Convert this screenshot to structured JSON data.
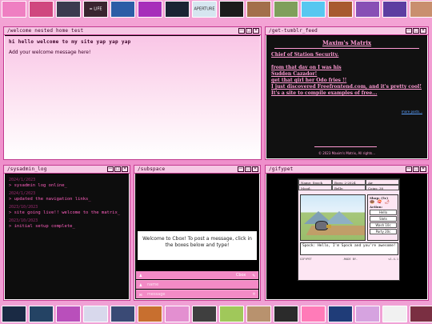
{
  "top_strip": [
    {
      "color": "#ef7fc2"
    },
    {
      "color": "#d0477f"
    },
    {
      "color": "#3b3b4f"
    },
    {
      "color": "#3a2430"
    },
    {
      "color": "#2c5da6"
    },
    {
      "color": "#a72fba"
    },
    {
      "color": "#1a2433"
    },
    {
      "color": "#d6e6f0"
    },
    {
      "color": "#1b1b1b"
    },
    {
      "color": "#a36f4a"
    },
    {
      "color": "#7f9f5b"
    },
    {
      "color": "#57c7f0"
    },
    {
      "color": "#a85a2f"
    },
    {
      "color": "#884fb5"
    },
    {
      "color": "#5d3da1"
    },
    {
      "color": "#c98f6e"
    },
    {
      "color": "#332233"
    }
  ],
  "top_strip_text": {
    "life": "= LIFE",
    "aperture": "APERTURE"
  },
  "bottom_strip": [
    {
      "color": "#1a2a44"
    },
    {
      "color": "#244364"
    },
    {
      "color": "#b94fbb"
    },
    {
      "color": "#d8d8ec"
    },
    {
      "color": "#3a4a75"
    },
    {
      "color": "#c86f2f"
    },
    {
      "color": "#e38fd0"
    },
    {
      "color": "#3f3f3f"
    },
    {
      "color": "#a0c85a"
    },
    {
      "color": "#b8926e"
    },
    {
      "color": "#2b2b2b"
    },
    {
      "color": "#ff7bb8"
    },
    {
      "color": "#1f3c78"
    },
    {
      "color": "#d6a3e0"
    },
    {
      "color": "#f1f1f1"
    },
    {
      "color": "#7a2f42"
    },
    {
      "color": "#d49b61"
    }
  ],
  "windows": {
    "w1": {
      "title": "/welcome nested home test",
      "heading": "hi hello welcome to my site yap yap yap",
      "text": "Add your welcome message here!"
    },
    "w2": {
      "title": "/get-tumblr_feed",
      "blog_title": "Maxim's Matrix",
      "entries": [
        "Chief of Station Security.",
        "from that day on I was his",
        "Sudden Cazador!",
        "get that girl her Odo fries !!",
        "I just discovered Freefrontend.com, and it's pretty cool! It's a site to compile examples of free..."
      ],
      "more": "more posts...",
      "copy": "© 2023 Maxim's Matrix, All rights..."
    },
    "w3": {
      "title": "/sysadmin_log",
      "logs": [
        {
          "date": "2024/1/2023",
          "msg": "> sysadmin log online_"
        },
        {
          "date": "2024/1/2023",
          "msg": "> updated the navigation links_"
        },
        {
          "date": "2023/10/2023",
          "msg": "> site going live!! welcome to the matrix_"
        },
        {
          "date": "2023/10/2023",
          "msg": "> initial setup complete_"
        }
      ]
    },
    "w4": {
      "title": "/subspace",
      "notice": "Welcome to Cbox! To post a message, click in the boxes below and type!",
      "cbox_label": "Cbox",
      "name_placeholder": "name",
      "message_placeholder": "message"
    },
    "w5": {
      "title": "/gifypet",
      "name": "Name: Spock",
      "born": "Born: 2-2024",
      "element": "Air",
      "mood": "Mood:",
      "belly": "Belly:",
      "coins": "Coins: 38",
      "shop": "Shop: (5c)",
      "foods": "🍩 🍣 🌶",
      "action": "Action:",
      "buttons": [
        "Hello",
        "Slots",
        "Wash 10c",
        "Party 20c"
      ],
      "speech": "Spock: Hello, I'm Spock and you're awesome!",
      "foot_left": "GIFYPET",
      "foot_mid": "-MADE BY-",
      "foot_right": "v1.4.1"
    }
  },
  "ui_controls": {
    "minimize": "—",
    "maximize": "□",
    "close": "✕"
  },
  "ui_icons": {
    "chat": "✎",
    "edit": "✎",
    "user": "♟",
    "msg": "✉",
    "smile": "☺"
  }
}
